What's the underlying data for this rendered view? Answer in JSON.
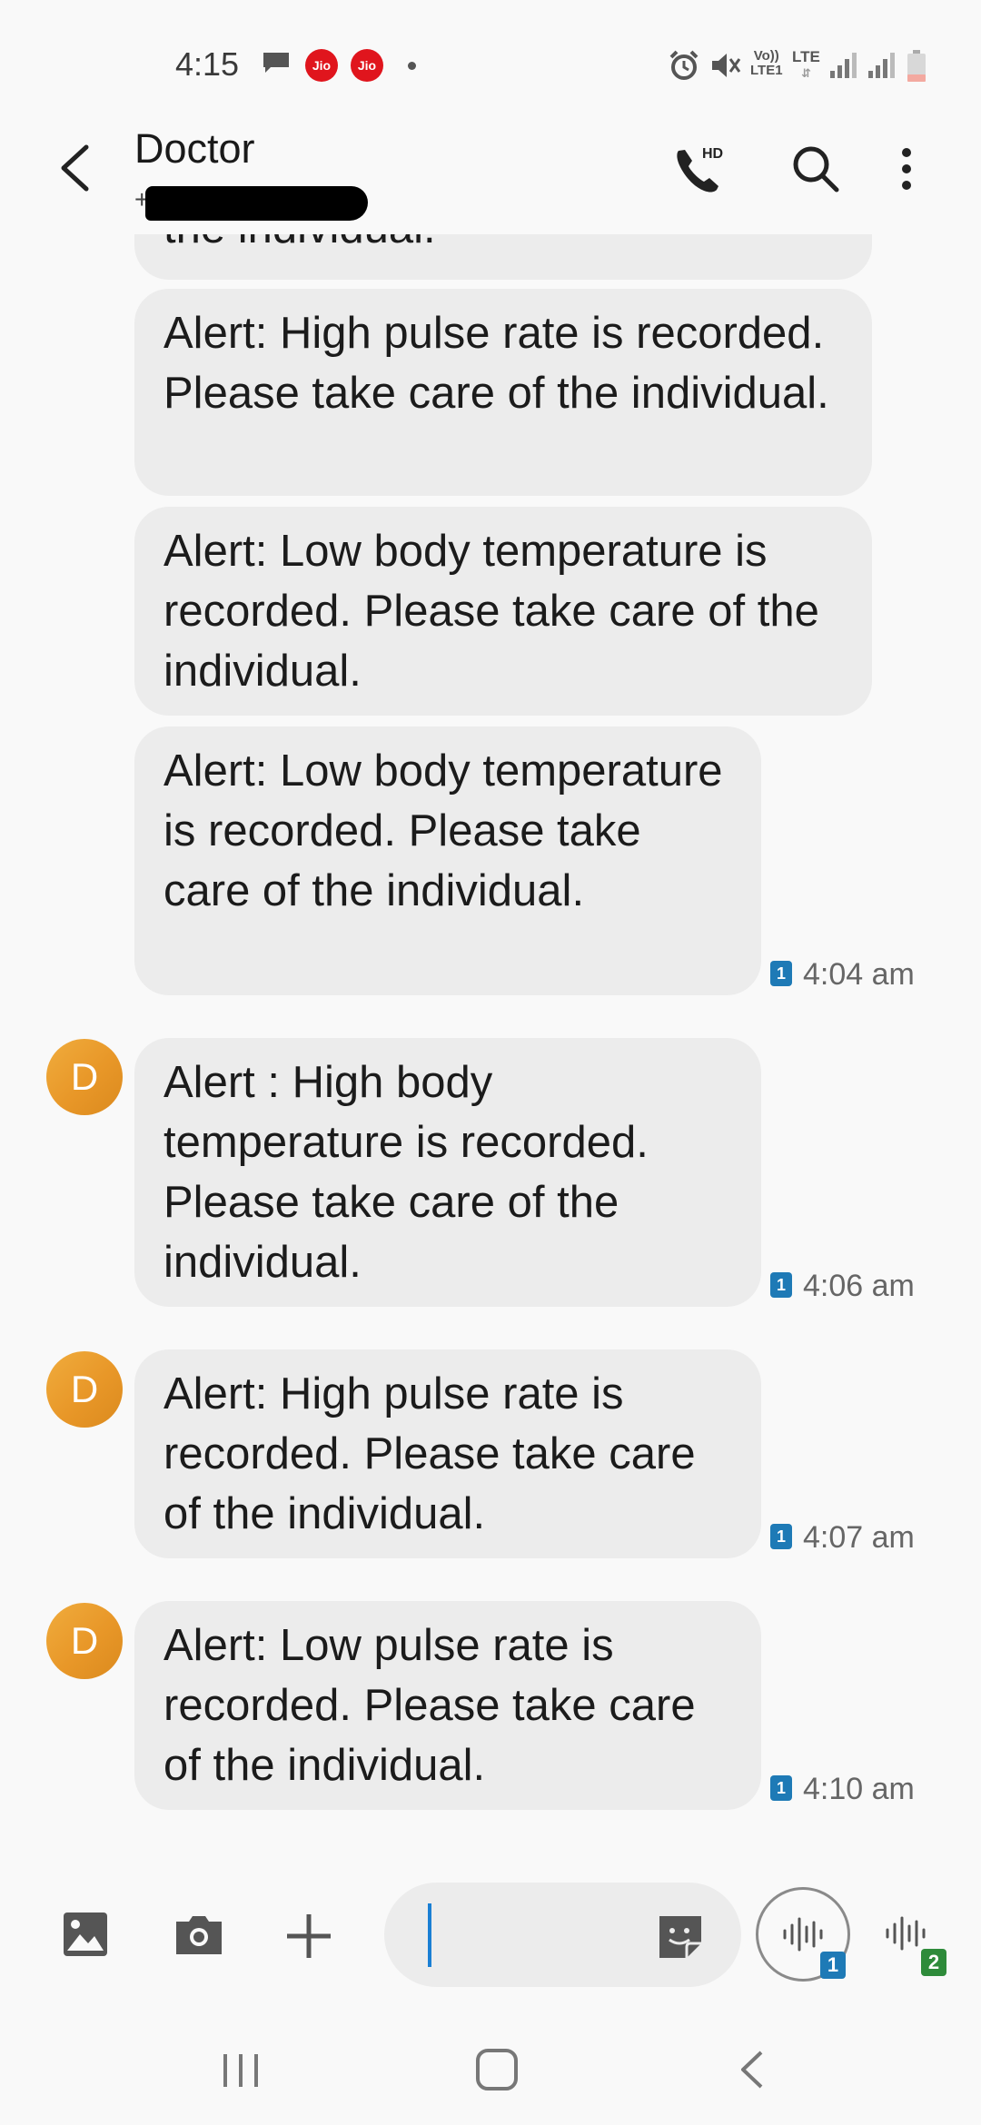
{
  "status_bar": {
    "time": "4:15",
    "carrier_badges": [
      "Jio",
      "Jio"
    ],
    "volte_label": [
      "Vo))",
      "LTE1"
    ],
    "lte_label": "LTE"
  },
  "header": {
    "contact_name": "Doctor",
    "phone_prefix": "+"
  },
  "messages": [
    {
      "text": "the individual.",
      "partial": true
    },
    {
      "text": "Alert: High pulse rate is recorded. Please take care of the individual.",
      "time": ""
    },
    {
      "text": "Alert: Low body temperature is recorded. Please take care of the individual.",
      "time": ""
    },
    {
      "text": "Alert: Low body temperature is recorded. Please take care of the individual.",
      "time": "4:04 am",
      "sim": "1"
    },
    {
      "text": "Alert : High body temperature is recorded. Please take care of the individual.",
      "time": "4:06 am",
      "sim": "1",
      "avatar": "D"
    },
    {
      "text": "Alert: High pulse rate is recorded. Please take care of the individual.",
      "time": "4:07 am",
      "sim": "1",
      "avatar": "D"
    },
    {
      "text": "Alert: Low pulse rate is recorded. Please take care of the individual.",
      "time": "4:10 am",
      "sim": "1",
      "avatar": "D"
    }
  ],
  "composer": {
    "input_value": "",
    "voice_sim_1": "1",
    "voice_sim_2": "2"
  },
  "colors": {
    "bubble": "#ececec",
    "avatar": "#e89728",
    "sim_badge": "#1e7ab6",
    "sim2_badge": "#2e8b3a",
    "caret": "#1a7fd4",
    "jio_red": "#e0151d"
  },
  "icons": [
    "back-arrow-icon",
    "hd-call-icon",
    "search-icon",
    "more-options-icon",
    "gallery-icon",
    "camera-icon",
    "add-icon",
    "sticker-icon",
    "voice-record-icon"
  ]
}
